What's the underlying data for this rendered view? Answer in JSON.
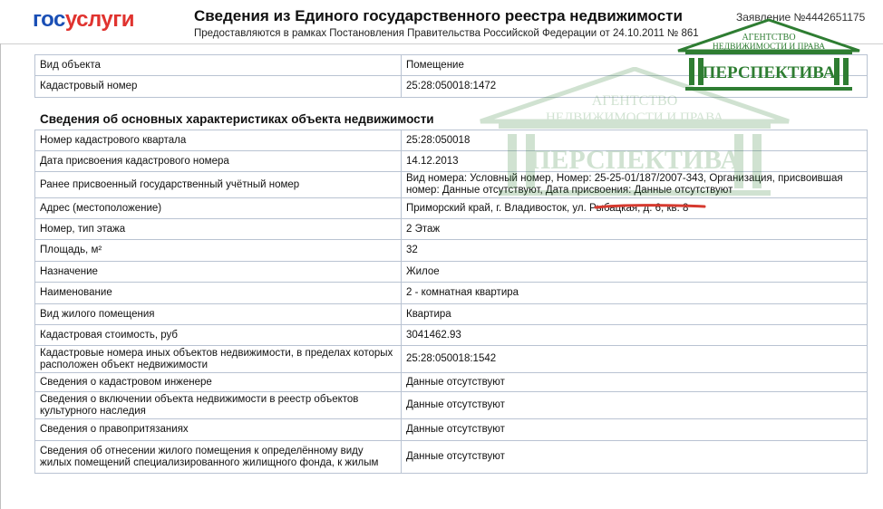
{
  "header": {
    "logo_part1": "гос",
    "logo_part2": "услуги",
    "title": "Сведения из Единого государственного реестра недвижимости",
    "subtitle": "Предоставляются в рамках Постановления Правительства Российской Федерации от 24.10.2011 № 861",
    "application": "Заявление №4442651175"
  },
  "watermark": {
    "line1": "АГЕНТСТВО",
    "line2": "НЕДВИЖИМОСТИ И ПРАВА",
    "name": "ПЕРСПЕКТИВА",
    "color": "#2e7d32"
  },
  "top_table": [
    {
      "label": "Вид объекта",
      "value": "Помещение"
    },
    {
      "label": "Кадастровый номер",
      "value": "25:28:050018:1472"
    }
  ],
  "section_title": "Сведения об основных характеристиках объекта недвижимости",
  "main_table": [
    {
      "label": "Номер кадастрового квартала",
      "value": "25:28:050018"
    },
    {
      "label": "Дата присвоения кадастрового номера",
      "value": "14.12.2013"
    },
    {
      "label": "Ранее присвоенный государственный учётный номер",
      "value": "Вид номера: Условный номер, Номер: 25-25-01/187/2007-343, Организация, присвоившая номер: Данные отсутствуют, Дата присвоения: Данные отсутствуют"
    },
    {
      "label": "Адрес (местоположение)",
      "value": "Приморский край, г. Владивосток, ул. Рыбацкая, д. 6, кв. 8"
    },
    {
      "label": "Номер, тип этажа",
      "value": "2 Этаж"
    },
    {
      "label": "Площадь, м²",
      "value": "32"
    },
    {
      "label": "Назначение",
      "value": "Жилое"
    },
    {
      "label": "Наименование",
      "value": "2 - комнатная квартира"
    },
    {
      "label": "Вид жилого помещения",
      "value": "Квартира"
    },
    {
      "label": "Кадастровая стоимость, руб",
      "value": "3041462.93"
    },
    {
      "label": "Кадастровые номера иных объектов недвижимости, в пределах которых расположен объект недвижимости",
      "value": "25:28:050018:1542"
    },
    {
      "label": "Сведения о кадастровом инженере",
      "value": "Данные отсутствуют"
    },
    {
      "label": "Сведения о включении объекта недвижимости в реестр объектов культурного наследия",
      "value": "Данные отсутствуют"
    },
    {
      "label": "Сведения о правопритязаниях",
      "value": "Данные отсутствуют"
    },
    {
      "label": "Сведения об отнесении жилого помещения к определённому виду жилых помещений специализированного жилищного фонда, к жилым",
      "value": "Данные отсутствуют"
    }
  ]
}
